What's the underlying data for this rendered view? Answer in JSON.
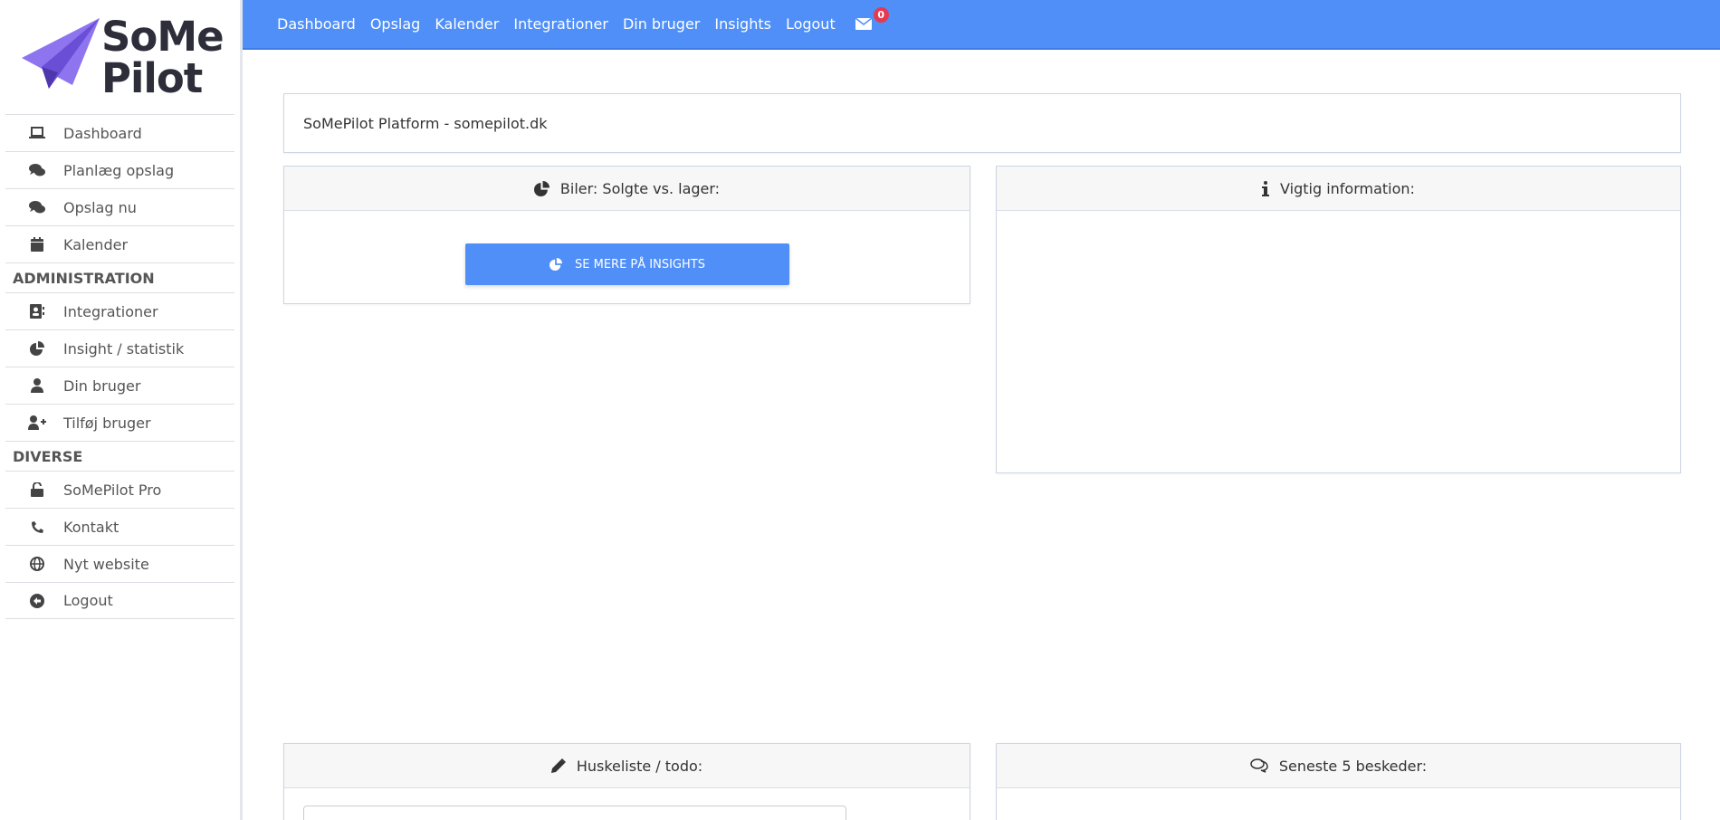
{
  "logo": {
    "line1": "SoMe",
    "line2": "Pilot"
  },
  "sidebar": {
    "items_top": [
      {
        "label": "Dashboard",
        "icon": "laptop-icon"
      },
      {
        "label": "Planlæg opslag",
        "icon": "comments-icon"
      },
      {
        "label": "Opslag nu",
        "icon": "comments-icon"
      },
      {
        "label": "Kalender",
        "icon": "calendar-icon"
      }
    ],
    "heading_admin": "ADMINISTRATION",
    "items_admin": [
      {
        "label": "Integrationer",
        "icon": "address-book-icon"
      },
      {
        "label": "Insight / statistik",
        "icon": "pie-chart-icon"
      },
      {
        "label": "Din bruger",
        "icon": "user-icon"
      },
      {
        "label": "Tilføj bruger",
        "icon": "user-plus-icon"
      }
    ],
    "heading_diverse": "DIVERSE",
    "items_diverse": [
      {
        "label": "SoMePilot Pro",
        "icon": "unlock-icon"
      },
      {
        "label": "Kontakt",
        "icon": "phone-icon"
      },
      {
        "label": "Nyt website",
        "icon": "globe-icon"
      },
      {
        "label": "Logout",
        "icon": "arrow-left-circle-icon"
      }
    ]
  },
  "topbar": {
    "links": [
      "Dashboard",
      "Opslag",
      "Kalender",
      "Integrationer",
      "Din bruger",
      "Insights",
      "Logout"
    ],
    "mail_count": "0"
  },
  "platform_title": "SoMePilot Platform - somepilot.dk",
  "cards": {
    "cars_title": "Biler: Solgte vs. lager:",
    "cars_button": "SE MERE PÅ INSIGHTS",
    "info_title": "Vigtig information:",
    "todo_title": "Huskeliste / todo:",
    "messages_title": "Seneste 5 beskeder:"
  },
  "colors": {
    "primary": "#4f8ff7",
    "badge": "#e53950",
    "logo_purple": "#7b5ce6"
  }
}
